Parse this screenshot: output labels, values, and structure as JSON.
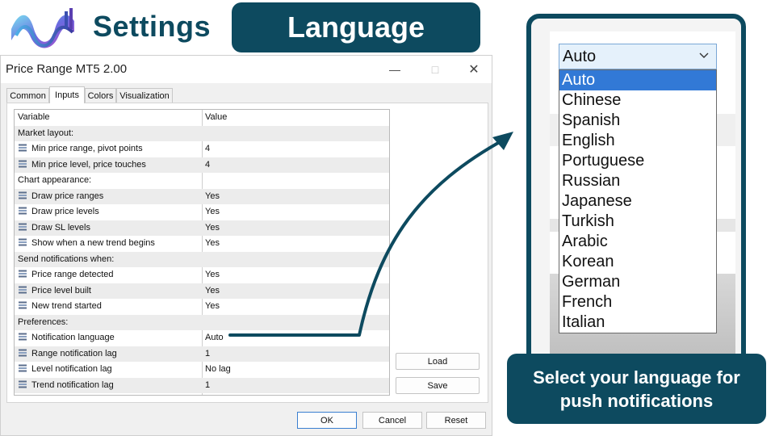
{
  "header": {
    "settings_label": "Settings",
    "language_label": "Language"
  },
  "window": {
    "title": "Price Range MT5 2.00"
  },
  "tabs": [
    {
      "label": "Common",
      "active": false
    },
    {
      "label": "Inputs",
      "active": true
    },
    {
      "label": "Colors",
      "active": false
    },
    {
      "label": "Visualization",
      "active": false
    }
  ],
  "grid": {
    "headers": {
      "variable": "Variable",
      "value": "Value"
    },
    "rows": [
      {
        "variable": "Market layout:",
        "value": "",
        "param": false
      },
      {
        "variable": "Min price range, pivot points",
        "value": "4",
        "param": true
      },
      {
        "variable": "Min price level, price touches",
        "value": "4",
        "param": true
      },
      {
        "variable": "Chart appearance:",
        "value": "",
        "param": false
      },
      {
        "variable": "Draw price ranges",
        "value": "Yes",
        "param": true
      },
      {
        "variable": "Draw price levels",
        "value": "Yes",
        "param": true
      },
      {
        "variable": "Draw SL levels",
        "value": "Yes",
        "param": true
      },
      {
        "variable": "Show when a new trend begins",
        "value": "Yes",
        "param": true
      },
      {
        "variable": "Send notifications when:",
        "value": "",
        "param": false
      },
      {
        "variable": "Price range detected",
        "value": "Yes",
        "param": true
      },
      {
        "variable": "Price level built",
        "value": "Yes",
        "param": true
      },
      {
        "variable": "New trend started",
        "value": "Yes",
        "param": true
      },
      {
        "variable": "Preferences:",
        "value": "",
        "param": false
      },
      {
        "variable": "Notification language",
        "value": "Auto",
        "param": true
      },
      {
        "variable": "Range notification lag",
        "value": "1",
        "param": true
      },
      {
        "variable": "Level notification lag",
        "value": "No lag",
        "param": true
      },
      {
        "variable": "Trend notification lag",
        "value": "1",
        "param": true
      }
    ]
  },
  "buttons": {
    "load": "Load",
    "save": "Save",
    "ok": "OK",
    "cancel": "Cancel",
    "reset": "Reset"
  },
  "language_select": {
    "selected": "Auto",
    "options": [
      "Auto",
      "Chinese",
      "Spanish",
      "English",
      "Portuguese",
      "Russian",
      "Japanese",
      "Turkish",
      "Arabic",
      "Korean",
      "German",
      "French",
      "Italian"
    ]
  },
  "callout": {
    "text": "Select your language for push notifications"
  },
  "colors": {
    "brand": "#0d4a5f",
    "selection": "#3279d6"
  },
  "icons": {
    "logo": "wave-logo-icon",
    "param": "parameter-icon",
    "dropdown": "chevron-down-icon",
    "arrow": "curved-arrow-icon"
  }
}
